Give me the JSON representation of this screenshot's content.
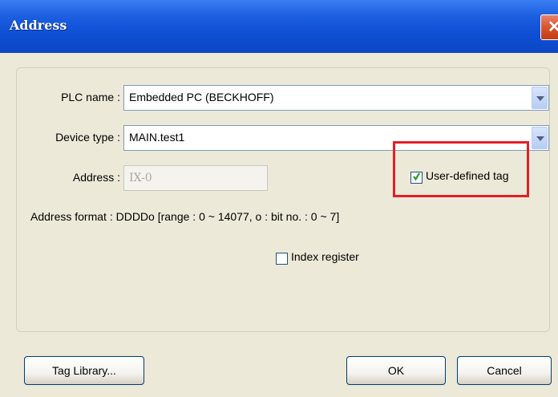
{
  "window": {
    "title": "Address"
  },
  "form": {
    "plc_name_label": "PLC name :",
    "plc_name_value": "Embedded PC (BECKHOFF)",
    "device_type_label": "Device type :",
    "device_type_value": "MAIN.test1",
    "address_label": "Address :",
    "address_value": "IX-0",
    "user_defined_tag_label": "User-defined tag",
    "user_defined_tag_checked": true,
    "address_format_text": "Address format : DDDDo [range : 0 ~ 14077, o : bit no. : 0 ~ 7]",
    "index_register_label": "Index register",
    "index_register_checked": false
  },
  "buttons": {
    "tag_library": "Tag Library...",
    "ok": "OK",
    "cancel": "Cancel"
  },
  "colors": {
    "title_bar": "#0b47c4",
    "highlight": "#e41e26",
    "check_green": "#21a121"
  }
}
